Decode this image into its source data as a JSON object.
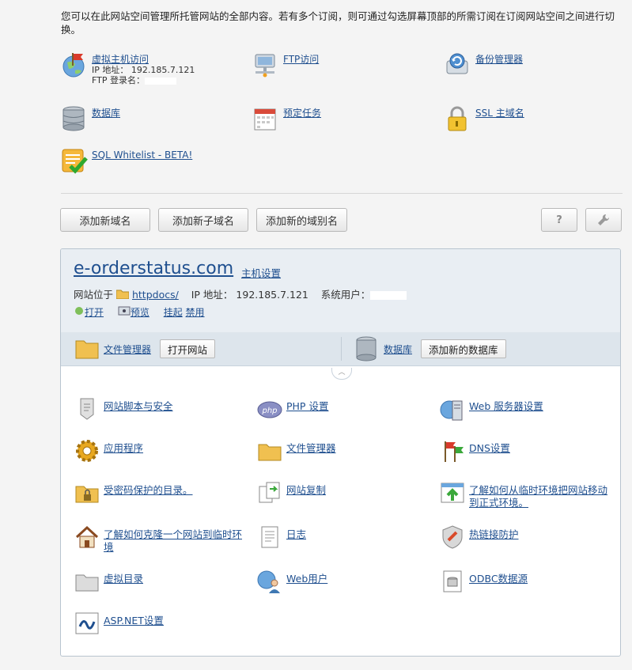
{
  "intro": "您可以在此网站空间管理所托管网站的全部内容。若有多个订阅，则可通过勾选屏幕顶部的所需订阅在订阅网站空间之间进行切换。",
  "tools": {
    "vhost": {
      "label": "虚拟主机访问",
      "ip_line": "IP 地址： 192.185.7.121",
      "ftp_line": "FTP 登录名："
    },
    "ftp": {
      "label": "FTP访问"
    },
    "backup": {
      "label": "备份管理器"
    },
    "database": {
      "label": "数据库"
    },
    "scheduled": {
      "label": "预定任务"
    },
    "ssl": {
      "label": "SSL 主域名"
    },
    "sqlwl": {
      "label": "SQL Whitelist - BETA!"
    }
  },
  "buttons": {
    "add_domain": "添加新域名",
    "add_subdomain": "添加新子域名",
    "add_alias": "添加新的域别名",
    "help": "?"
  },
  "site": {
    "domain": "e-orderstatus.com",
    "host_settings": "主机设置",
    "located_prefix": "网站位于",
    "docroot": "httpdocs/",
    "ip_label": "IP 地址：",
    "ip": "192.185.7.121",
    "sysuser_label": "系统用户：",
    "actions": {
      "open": "打开",
      "preview": "预览",
      "suspend": "挂起",
      "disable": "禁用"
    }
  },
  "bar": {
    "file_manager": "文件管理器",
    "open_site": "打开网站",
    "databases": "数据库",
    "add_database": "添加新的数据库"
  },
  "features": {
    "scripts_security": "网站脚本与安全",
    "php": "PHP 设置",
    "web_server": "Web 服务器设置",
    "apps": "应用程序",
    "file_manager": "文件管理器",
    "dns": "DNS设置",
    "protected_dirs": "受密码保护的目录。",
    "site_copy": "网站复制",
    "staging_move": "了解如何从临时环境把网站移动到正式环境。",
    "clone_staging": "了解如何克隆一个网站到临时环境",
    "logs": "日志",
    "hotlink": "热链接防护",
    "virtual_dirs": "虚拟目录",
    "web_users": "Web用户",
    "odbc": "ODBC数据源",
    "aspnet": "ASP.NET设置"
  }
}
